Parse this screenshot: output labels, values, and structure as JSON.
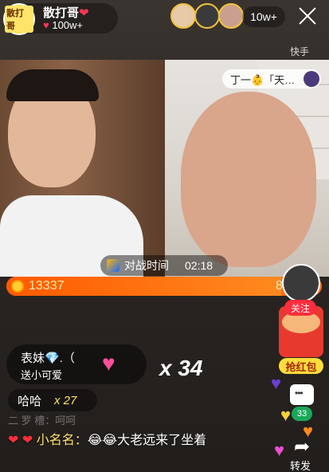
{
  "header": {
    "logo_text": "散打哥",
    "host_name": "散打哥",
    "host_heart": "❤",
    "likes_icon": "heart-icon",
    "likes": "100w+",
    "viewers": "10w+"
  },
  "brand": "快手",
  "opponent_tag": "丁一👶「天…",
  "battle": {
    "label": "对战时间",
    "time": "02:18",
    "score_left": "13337",
    "score_right": "8",
    "left_share": 0.87
  },
  "side": {
    "follow_label": "关注",
    "redpack_label": "抢红包",
    "comment_count": "33",
    "share_label": "转发"
  },
  "gift": {
    "title": "表妹💎.（",
    "subtitle": "送小可爱",
    "icon": "winged-heart-icon",
    "count": "x 34"
  },
  "combo": {
    "text": "哈哈",
    "count": "x 27"
  },
  "faded_line": "二 罗 槽：呵呵",
  "chat": {
    "hearts": "❤ ❤",
    "name": "小名名：",
    "message": "😂😂大老远来了坐着"
  },
  "colors": {
    "accent": "#ff6b1a",
    "follow": "#ff2d3d",
    "redpack": "#e8392f",
    "highlight": "#ffe36e"
  }
}
